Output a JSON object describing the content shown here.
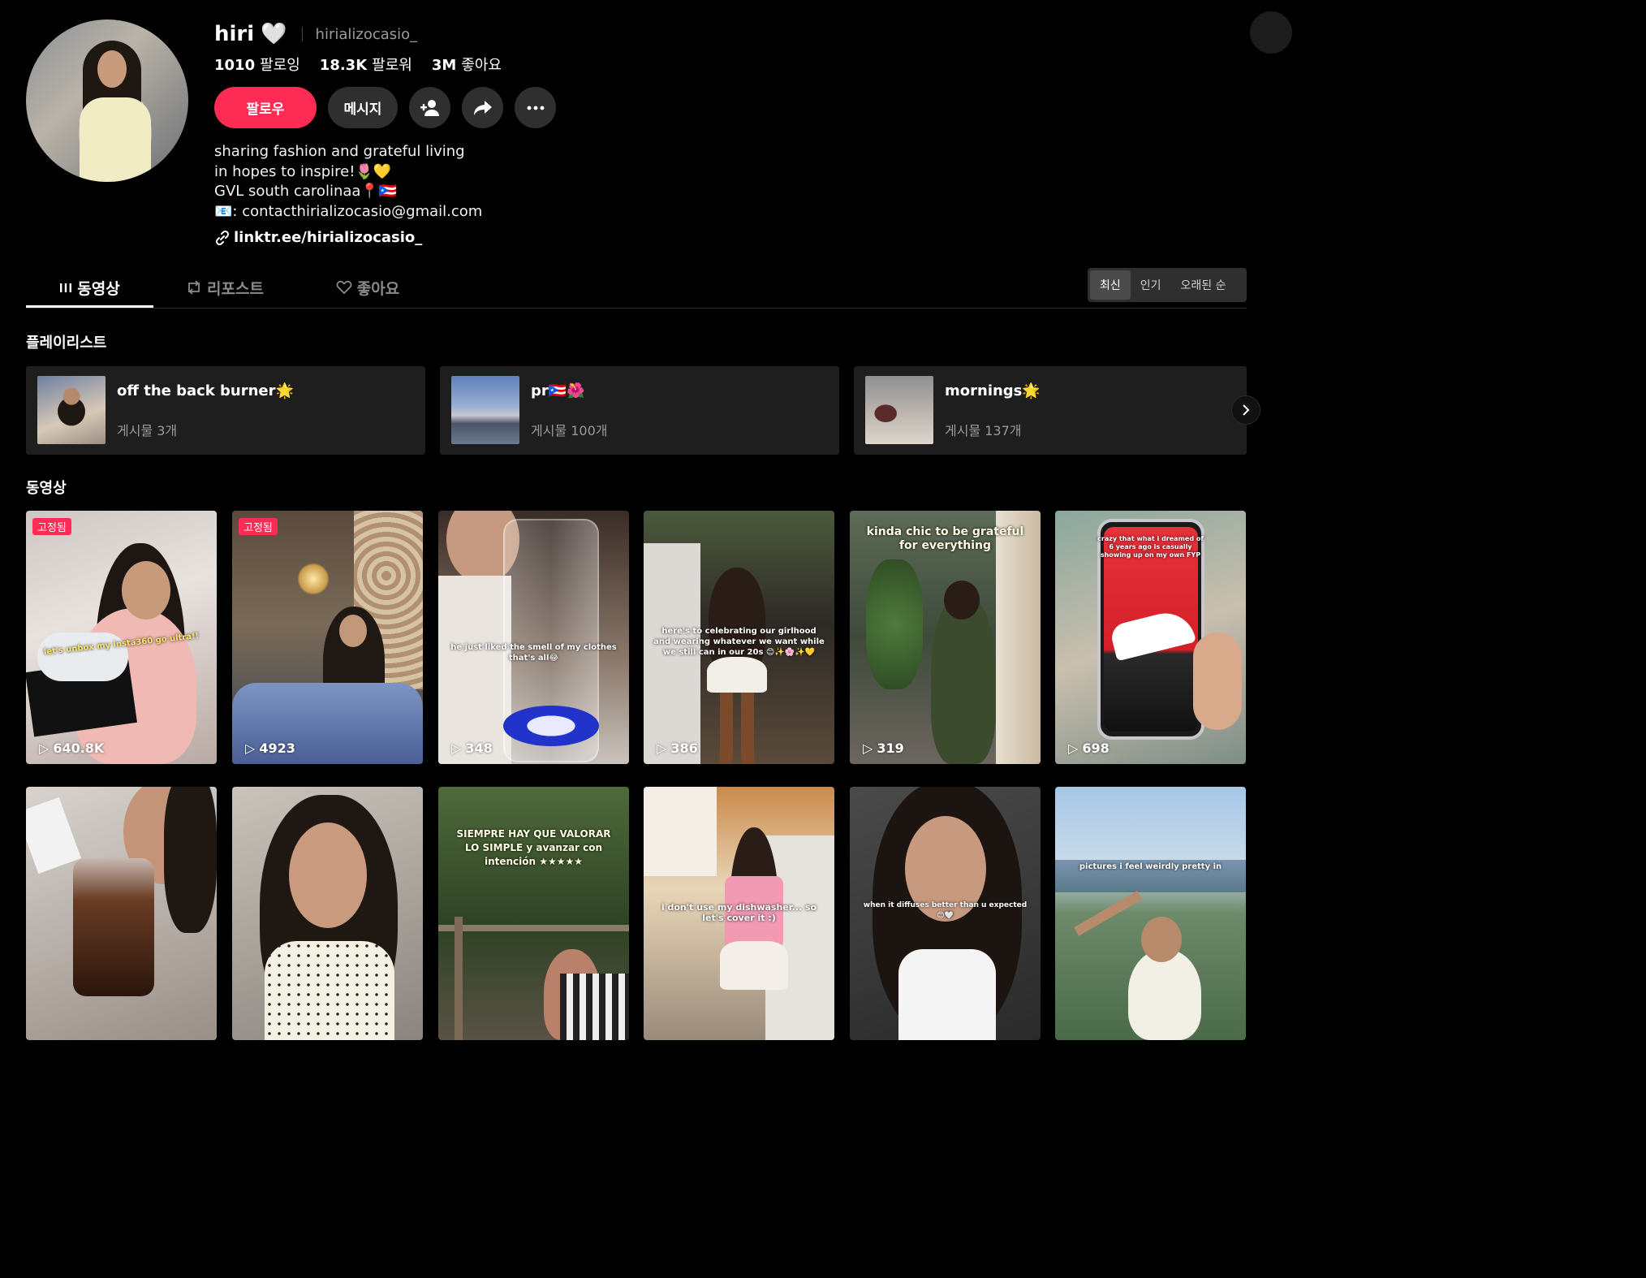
{
  "profile": {
    "username": "hiri",
    "handle": "hirializocasio_",
    "stats": [
      {
        "value": "1010",
        "label": "팔로잉"
      },
      {
        "value": "18.3K",
        "label": "팔로워"
      },
      {
        "value": "3M",
        "label": "좋아요"
      }
    ],
    "follow_label": "팔로우",
    "message_label": "메시지",
    "bio": [
      "sharing fashion and grateful living",
      "in hopes to inspire!🌷💛",
      "GVL south carolinaa📍🇵🇷",
      "📧: contacthirializocasio@gmail.com"
    ],
    "link": "linktr.ee/hirializocasio_"
  },
  "tabs": [
    {
      "label": "동영상"
    },
    {
      "label": "리포스트"
    },
    {
      "label": "좋아요"
    }
  ],
  "sort": [
    "최신",
    "인기",
    "오래된 순"
  ],
  "playlists_title": "플레이리스트",
  "playlists": [
    {
      "title": "off the back burner🌟",
      "count": "게시물 3개"
    },
    {
      "title": "pr🇵🇷🌺",
      "count": "게시물 100개"
    },
    {
      "title": "mornings🌟",
      "count": "게시물 137개"
    }
  ],
  "videos_title": "동영상",
  "videos": [
    {
      "pinned": "고정됨",
      "views": "640.8K",
      "caption": "let's unbox my insta360 go ultra!!"
    },
    {
      "pinned": "고정됨",
      "views": "4923",
      "caption": ""
    },
    {
      "pinned": "",
      "views": "348",
      "caption": "he just liked the smell of my clothes that's all😂"
    },
    {
      "pinned": "",
      "views": "386",
      "caption": "here's to celebrating our girlhood and wearing whatever we want while we still can in our 20s 😊✨🌸✨💛"
    },
    {
      "pinned": "",
      "views": "319",
      "caption": "kinda chic to be grateful for everything"
    },
    {
      "pinned": "",
      "views": "698",
      "caption": "crazy that what i dreamed of 6 years ago is casually showing up on my own FYP"
    },
    {
      "pinned": "",
      "views": "",
      "caption": ""
    },
    {
      "pinned": "",
      "views": "",
      "caption": ""
    },
    {
      "pinned": "",
      "views": "",
      "caption": "SIEMPRE HAY QUE VALORAR LO SIMPLE y avanzar con intención ★★★★★"
    },
    {
      "pinned": "",
      "views": "",
      "caption": "i don't use my dishwasher... so let's cover it :)"
    },
    {
      "pinned": "",
      "views": "",
      "caption": "when it diffuses better than u expected 😊🤍"
    },
    {
      "pinned": "",
      "views": "",
      "caption": "pictures i feel weirdly pretty in"
    }
  ],
  "colors": {
    "accent": "#fe2c55",
    "button_bg": "#2f2f2f",
    "card_bg": "#1e1e1e"
  }
}
